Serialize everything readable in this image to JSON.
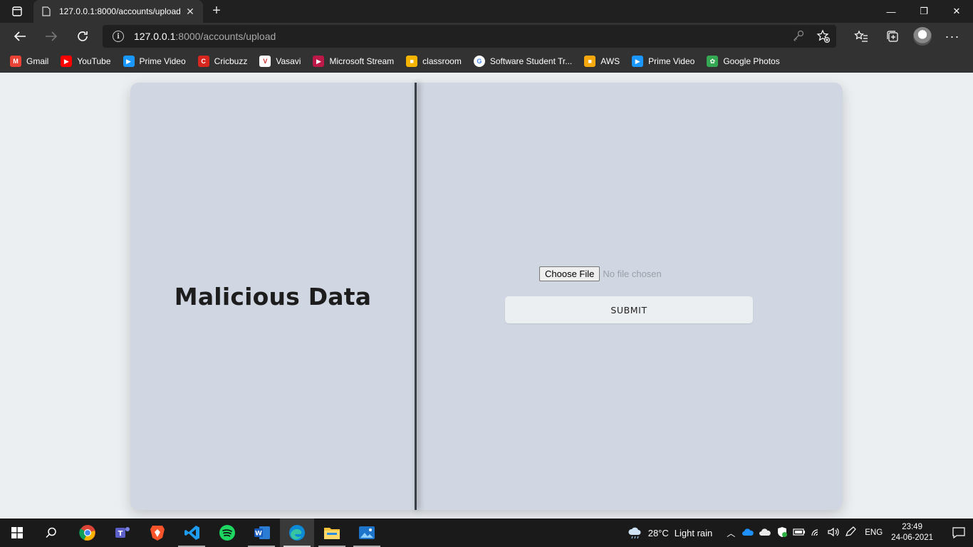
{
  "browser": {
    "tab_title": "127.0.0.1:8000/accounts/upload",
    "tab_close": "✕",
    "new_tab": "+",
    "url_host": "127.0.0.1",
    "url_rest": ":8000/accounts/upload",
    "window_controls": {
      "minimize": "—",
      "maximize": "❐",
      "close": "✕"
    }
  },
  "bookmarks": [
    {
      "label": "Gmail",
      "icon": "gmail-icon",
      "color": "#ea4335",
      "glyph": "M"
    },
    {
      "label": "YouTube",
      "icon": "youtube-icon",
      "color": "#ff0000",
      "glyph": "▶"
    },
    {
      "label": "Prime Video",
      "icon": "prime-video-icon",
      "color": "#1a98ff",
      "glyph": "▶"
    },
    {
      "label": "Cricbuzz",
      "icon": "cricbuzz-icon",
      "color": "#d7261e",
      "glyph": "C"
    },
    {
      "label": "Vasavi",
      "icon": "vasavi-icon",
      "color": "#ffffff",
      "glyph": "V"
    },
    {
      "label": "Microsoft Stream",
      "icon": "microsoft-stream-icon",
      "color": "#bc1948",
      "glyph": "▶"
    },
    {
      "label": "classroom",
      "icon": "classroom-icon",
      "color": "#f4b400",
      "glyph": "■"
    },
    {
      "label": "Software Student Tr...",
      "icon": "google-icon",
      "color": "#ffffff",
      "glyph": "G"
    },
    {
      "label": "AWS",
      "icon": "aws-icon",
      "color": "#f7a80d",
      "glyph": "■"
    },
    {
      "label": "Prime Video",
      "icon": "prime-video-icon",
      "color": "#1a98ff",
      "glyph": "▶"
    },
    {
      "label": "Google Photos",
      "icon": "google-photos-icon",
      "color": "#34a853",
      "glyph": "✿"
    }
  ],
  "page": {
    "title": "Malicious Data",
    "choose_file_label": "Choose File",
    "no_file_text": "No file chosen",
    "submit_label": "SUBMIT"
  },
  "taskbar": {
    "weather_temp": "28°C",
    "weather_desc": "Light rain",
    "language": "ENG",
    "time": "23:49",
    "date": "24-06-2021"
  }
}
